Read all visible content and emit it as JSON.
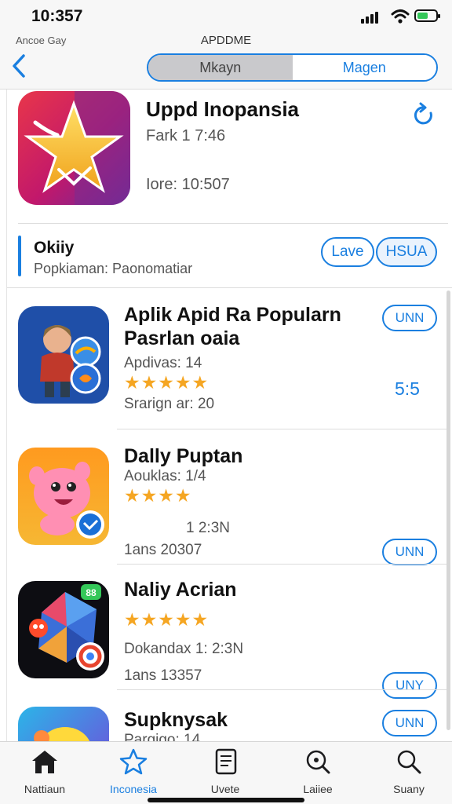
{
  "status_bar": {
    "time": "10:357"
  },
  "header": {
    "subtitle": "Ancoe Gay",
    "title": "APDDME",
    "segments": [
      "Mkayn",
      "Magen"
    ]
  },
  "featured": {
    "title": "Uppd Inopansia",
    "line1": "Fark 1 7:46",
    "line2": "Iore: 10:507"
  },
  "section": {
    "title": "Okiiy",
    "subtitle": "Popkiaman: Paonomatiar",
    "buttons": [
      "Lave",
      "HSUA"
    ]
  },
  "apps": [
    {
      "name": "Aplik Apid Ra Popularn Pasrlan oaia",
      "meta1": "Apdivas: 14",
      "stars": "★★★★★",
      "rating": 4.5,
      "meta2": "Srarign ar: 20",
      "extra": "5:5",
      "button": "UNN"
    },
    {
      "name": "Dally Puptan",
      "meta1": "Aouklas: 1/4",
      "stars": "★★★★",
      "rating": 4,
      "meta2": "1 2:3N",
      "meta3": "1ans 20307",
      "button": "UNN"
    },
    {
      "name": "Naliy Acrian",
      "stars": "★★★★★",
      "rating": 4.5,
      "meta1": "Dokandax 1: 2:3N",
      "meta2": "1ans 13357",
      "button": "UNY"
    },
    {
      "name": "Supknysak",
      "meta1": "Pargigo: 14",
      "button": "UNN"
    }
  ],
  "tabs": [
    {
      "label": "Nattiaun"
    },
    {
      "label": "Inconesia"
    },
    {
      "label": "Uvete"
    },
    {
      "label": "Laiiee"
    },
    {
      "label": "Suany"
    }
  ],
  "colors": {
    "accent": "#1a7fe0",
    "star": "#f5a623"
  }
}
